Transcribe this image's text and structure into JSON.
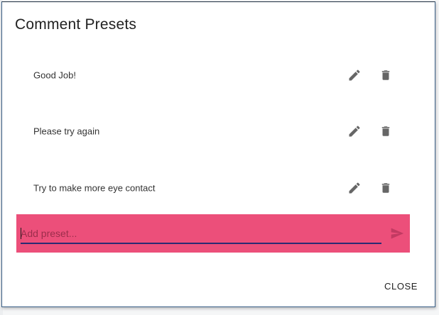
{
  "dialog": {
    "title": "Comment Presets",
    "presets": [
      {
        "label": "Good Job!"
      },
      {
        "label": "Please try again"
      },
      {
        "label": "Try to make more eye contact"
      }
    ],
    "add_input": {
      "placeholder": "Add preset...",
      "value": ""
    },
    "close_label": "CLOSE"
  },
  "colors": {
    "accent_bar": "#ec4f7a",
    "underline": "#2a2a72",
    "icon": "#666666"
  },
  "icons": {
    "edit": "pencil-icon",
    "delete": "trash-icon",
    "send": "send-icon"
  }
}
